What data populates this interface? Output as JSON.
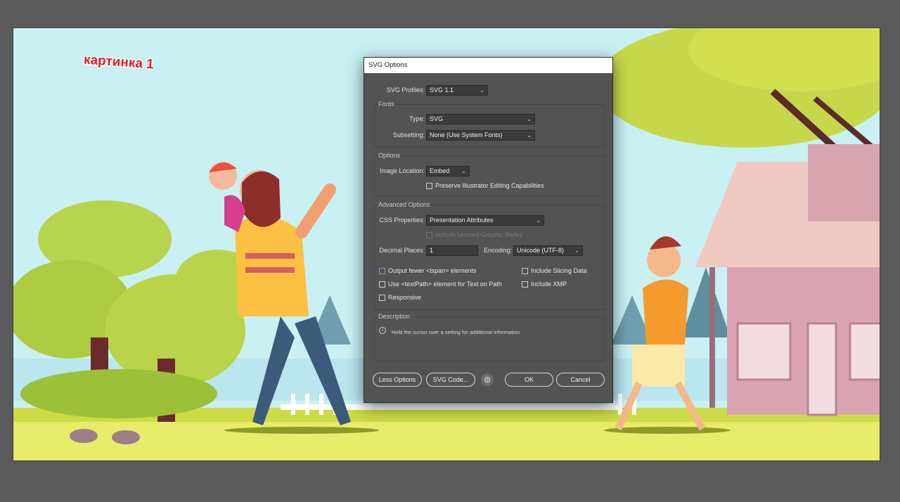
{
  "artboard": {
    "caption": "картинка 1"
  },
  "dialog": {
    "title": "SVG Options",
    "svg_profiles": {
      "label": "SVG Profiles:",
      "value": "SVG 1.1"
    },
    "fonts": {
      "title": "Fonts",
      "type": {
        "label": "Type:",
        "value": "SVG"
      },
      "subsetting": {
        "label": "Subsetting:",
        "value": "None (Use System Fonts)"
      }
    },
    "options": {
      "title": "Options",
      "image_location": {
        "label": "Image Location:",
        "value": "Embed"
      },
      "preserve_label": "Preserve Illustrator Editing Capabilities"
    },
    "advanced": {
      "title": "Advanced Options",
      "css_properties": {
        "label": "CSS Properties:",
        "value": "Presentation Attributes"
      },
      "include_unused_label": "Include Unused Graphic Styles",
      "decimal_places": {
        "label": "Decimal Places:",
        "value": "1"
      },
      "encoding": {
        "label": "Encoding:",
        "value": "Unicode (UTF-8)"
      },
      "output_fewer_label": "Output fewer <tspan> elements",
      "use_textpath_label": "Use <textPath> element for Text on Path",
      "responsive_label": "Responsive",
      "include_slicing_label": "Include Slicing Data",
      "include_xmp_label": "Include XMP"
    },
    "description": {
      "title": "Description",
      "text": "Hold the cursor over a setting for additional information."
    },
    "buttons": {
      "less_options": "Less Options",
      "svg_code": "SVG Code...",
      "ok": "OK",
      "cancel": "Cancel"
    }
  },
  "colors": {
    "sky": "#c9f1f4",
    "grass": "#d2dd4c",
    "dialog_bg": "#535353"
  }
}
